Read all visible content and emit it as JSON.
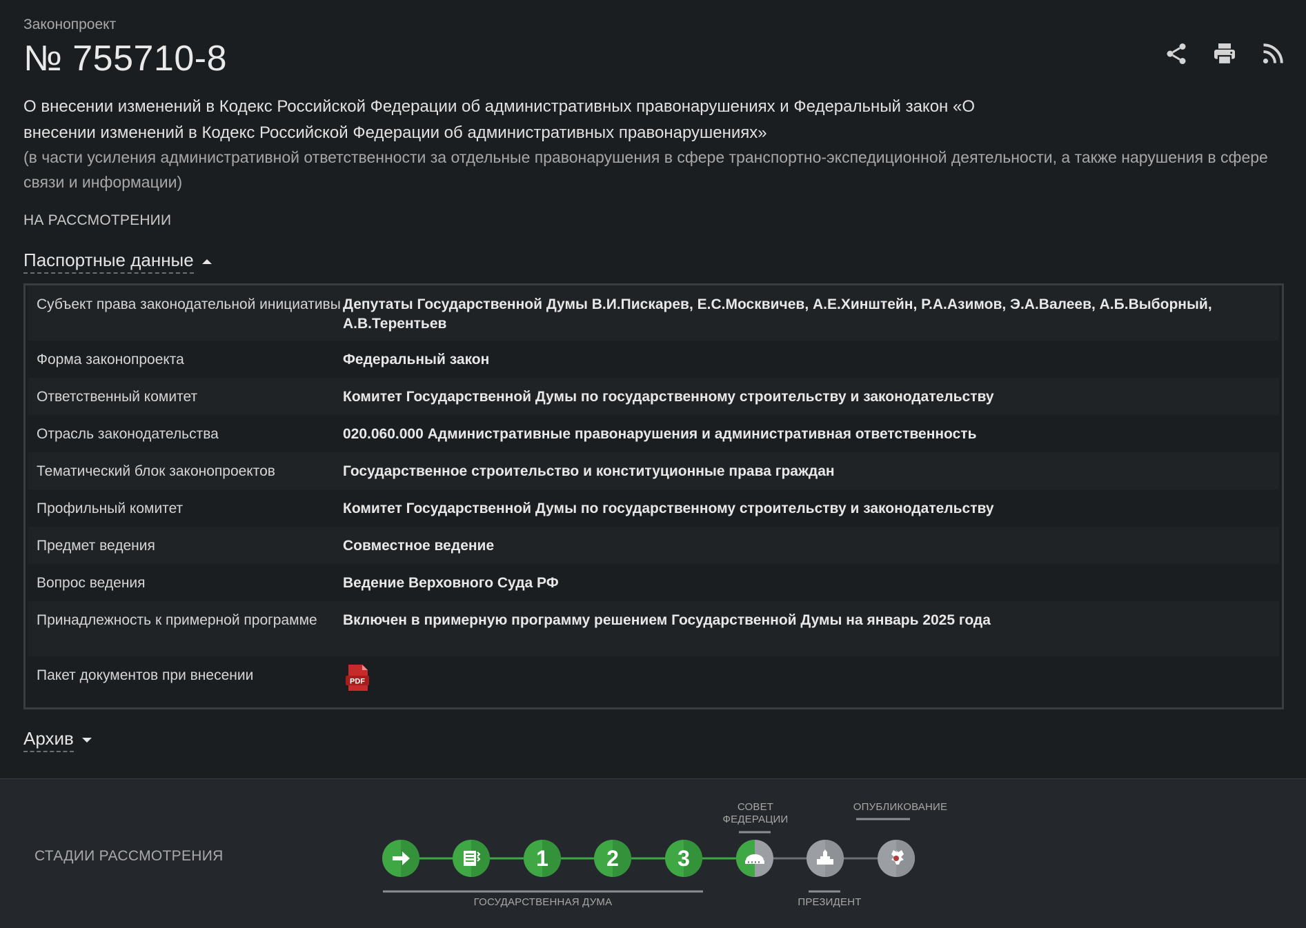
{
  "header": {
    "kicker": "Законопроект",
    "number": "№ 755710-8",
    "actions": {
      "share_icon": "share-icon",
      "print_icon": "print-icon",
      "rss_icon": "rss-icon"
    }
  },
  "bill": {
    "title": "О внесении изменений в Кодекс Российской Федерации об административных правонарушениях и Федеральный закон «О внесении изменений в Кодекс Российской Федерации об административных правонарушениях»",
    "subtitle": "(в части усиления административной ответственности за отдельные правонарушения в сфере транспортно-экспедиционной деятельности, а также нарушения в сфере связи и информации)",
    "status": "НА РАССМОТРЕНИИ"
  },
  "passport": {
    "toggle_label": "Паспортные данные",
    "rows": [
      {
        "key": "Субъект права законодательной инициативы",
        "value": "Депутаты Государственной Думы В.И.Пискарев, Е.С.Москвичев, А.Е.Хинштейн, Р.А.Азимов, Э.А.Валеев, А.Б.Выборный, А.В.Терентьев"
      },
      {
        "key": "Форма законопроекта",
        "value": "Федеральный закон"
      },
      {
        "key": "Ответственный комитет",
        "value": "Комитет Государственной Думы по государственному строительству и законодательству"
      },
      {
        "key": "Отрасль законодательства",
        "value": "020.060.000 Административные правонарушения и административная ответственность"
      },
      {
        "key": "Тематический блок законопроектов",
        "value": "Государственное строительство и конституционные права граждан"
      },
      {
        "key": "Профильный комитет",
        "value": "Комитет Государственной Думы по государственному строительству и законодательству"
      },
      {
        "key": "Предмет ведения",
        "value": "Совместное ведение"
      },
      {
        "key": "Вопрос ведения",
        "value": "Ведение Верховного Суда РФ"
      },
      {
        "key": "Принадлежность к примерной программе",
        "value": "Включен в примерную программу решением Государственной Думы на январь 2025 года"
      },
      {
        "key": "Пакет документов при внесении",
        "value": ""
      }
    ],
    "pdf_label": "PDF"
  },
  "archive": {
    "toggle_label": "Архив"
  },
  "stages": {
    "title": "СТАДИИ РАССМОТРЕНИЯ",
    "label_sovet": "СОВЕТ\nФЕДЕРАЦИИ",
    "label_publication": "ОПУБЛИКОВАНИЕ",
    "label_duma": "ГОСУДАРСТВЕННАЯ ДУМА",
    "label_president": "ПРЕЗИДЕНТ",
    "items": [
      {
        "icon": "arrow-right-icon",
        "done": true
      },
      {
        "icon": "document-list-icon",
        "done": true
      },
      {
        "text": "1",
        "done": true
      },
      {
        "text": "2",
        "done": true
      },
      {
        "text": "3",
        "done": true
      },
      {
        "icon": "federation-council-icon",
        "done": "partial"
      },
      {
        "icon": "kremlin-icon",
        "done": false
      },
      {
        "icon": "coat-of-arms-icon",
        "done": false
      }
    ],
    "colors": {
      "done": "#3fa845",
      "pending": "#9b9ea2",
      "line_done": "#3fa845",
      "line_pending": "#6d7074"
    }
  }
}
